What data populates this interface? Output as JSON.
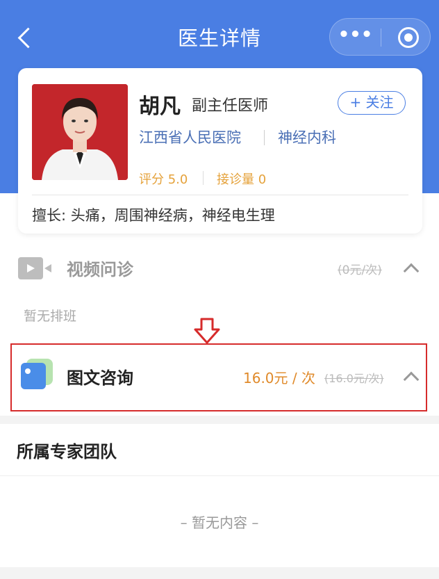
{
  "nav": {
    "title": "医生详情",
    "more": "•••"
  },
  "doctor": {
    "name": "胡凡",
    "title": "副主任医师",
    "follow": "+ 关注",
    "hospital": "江西省人民医院",
    "department": "神经内科",
    "rating": "评分 5.0",
    "visits": "接诊量 0",
    "specialty": "擅长: 头痛，周围神经病，神经电生理"
  },
  "services": {
    "video": {
      "label": "视频问诊",
      "price": "(0元/次)",
      "empty": "暂无排班"
    },
    "consult": {
      "label": "图文咨询",
      "price": "16.0元 / 次",
      "original": "(16.0元/次)"
    }
  },
  "team": {
    "title": "所属专家团队",
    "empty": "– 暂无内容 –"
  },
  "colors": {
    "primary": "#4a7ee3",
    "accent": "#e5a23b",
    "highlight": "#d62b2b"
  }
}
